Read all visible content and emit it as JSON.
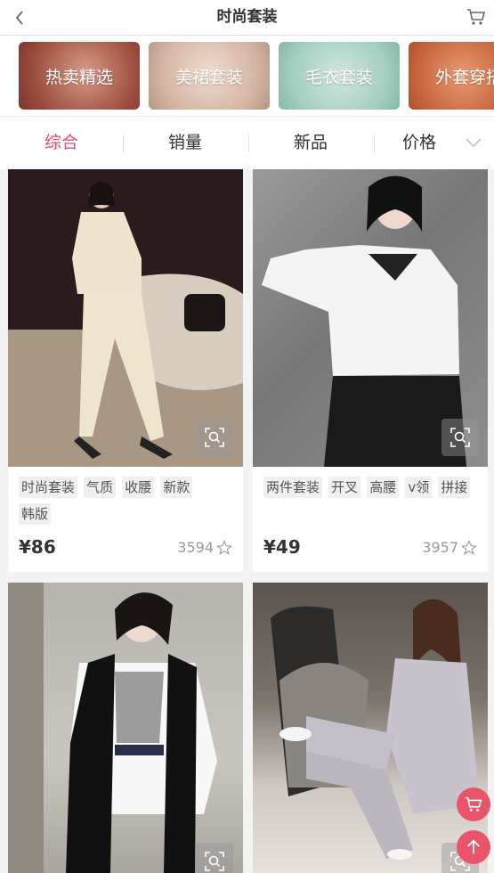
{
  "header": {
    "title": "时尚套装",
    "back_icon": "chevron-left-icon",
    "cart_icon": "cart-icon"
  },
  "categories": [
    {
      "label": "热卖精选",
      "color": "#b35a4a"
    },
    {
      "label": "美裙套装",
      "color": "#d0b5a3"
    },
    {
      "label": "毛衣套装",
      "color": "#a9d1c5"
    },
    {
      "label": "外套穿搭",
      "color": "#c4623a"
    }
  ],
  "sort": {
    "tabs": [
      "综合",
      "销量",
      "新品",
      "价格"
    ],
    "active": "综合",
    "active_color": "#e54b6f"
  },
  "products": [
    {
      "tags": [
        "时尚套装",
        "气质",
        "收腰",
        "新款",
        "韩版"
      ],
      "price": "¥86",
      "likes": "3594"
    },
    {
      "tags": [
        "两件套装",
        "开叉",
        "高腰",
        "v领",
        "拼接"
      ],
      "price": "¥49",
      "likes": "3957"
    },
    {
      "tags": [],
      "price": "",
      "likes": ""
    },
    {
      "tags": [],
      "price": "",
      "likes": ""
    }
  ],
  "floating": {
    "cart_icon": "cart-icon",
    "top_icon": "arrow-up-icon",
    "color": "#e9546b"
  }
}
